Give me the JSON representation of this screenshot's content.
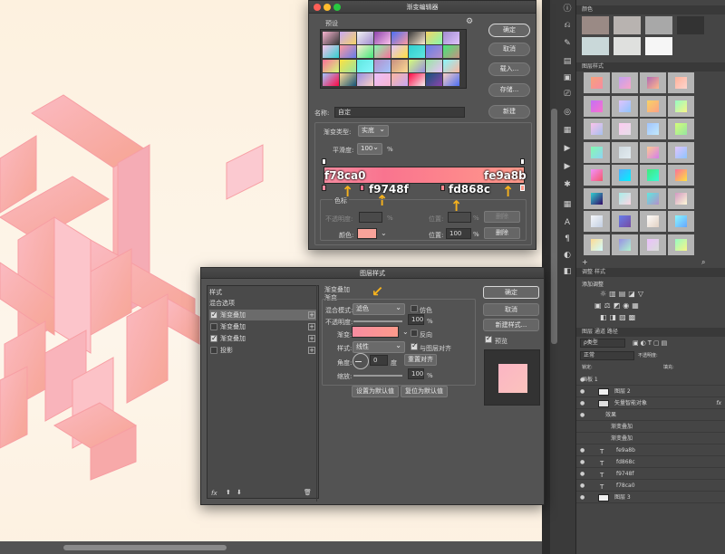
{
  "gradient_editor": {
    "title": "渐变编辑器",
    "presets_label": "预设",
    "gear_icon": "gear-icon",
    "buttons": {
      "ok": "确定",
      "cancel": "取消",
      "load": "载入...",
      "save": "存储...",
      "new": "新建"
    },
    "name_label": "名称:",
    "name_value": "自定",
    "type_label": "渐变类型:",
    "type_value": "实底",
    "smooth_label": "平滑度:",
    "smooth_value": "100",
    "smooth_unit": "%",
    "stops": [
      {
        "hex": "f78ca0",
        "color": "#f78ca0"
      },
      {
        "hex": "f9748f",
        "color": "#f9748f"
      },
      {
        "hex": "fd868c",
        "color": "#fd868c"
      },
      {
        "hex": "fe9a8b",
        "color": "#fe9a8b"
      }
    ],
    "color_stop_label": "色标",
    "opacity_label": "不透明度:",
    "opacity_unit": "%",
    "location_label": "位置:",
    "location_unit": "%",
    "delete_label": "删除",
    "color_label": "颜色:",
    "color_value": "#f9a39a",
    "location_value": "100",
    "delete2_label": "删除",
    "preset_colors": [
      "#f7b4d0",
      "#c9a8f4",
      "#f1f1f1",
      "#8e44ad",
      "#4c6ef5",
      "#3a3a3a",
      "#f6d365",
      "#a18cd1",
      "#fbc2eb",
      "#ff9a9e",
      "#ffecd2",
      "#84fab0",
      "#e0c3fc",
      "#30cfd0",
      "#667eea",
      "#43e97b",
      "#fa709a",
      "#fee140",
      "#5ee7df",
      "#b490ca",
      "#c79081",
      "#d4fc79",
      "#96e6a1",
      "#89f7fe",
      "#a1c4fd",
      "#fddb92",
      "#9890e3",
      "#ebc0fd",
      "#fcb69f",
      "#ff0844",
      "#13547a",
      "#fad0c4"
    ]
  },
  "layer_style": {
    "title": "图层样式",
    "styles_header": "样式",
    "blend_options": "混合选项",
    "items": [
      {
        "label": "渐变叠加",
        "checked": true,
        "selected": true
      },
      {
        "label": "渐变叠加",
        "checked": false,
        "selected": false
      },
      {
        "label": "渐变叠加",
        "checked": true,
        "selected": false
      },
      {
        "label": "投影",
        "checked": false,
        "selected": false
      }
    ],
    "section_title": "渐变叠加",
    "section_sub": "渐变",
    "blend_mode_label": "混合模式:",
    "blend_mode_value": "滤色",
    "dither_label": "仿色",
    "opacity_label": "不透明度:",
    "opacity_value": "100",
    "gradient_label": "渐变:",
    "reverse_label": "反向",
    "style_label": "样式:",
    "style_value": "线性",
    "align_label": "与图层对齐",
    "angle_label": "角度:",
    "angle_value": "0",
    "angle_unit": "度",
    "reset_align": "重置对齐",
    "scale_label": "缩放:",
    "scale_value": "100",
    "percent": "%",
    "set_default": "设置为默认值",
    "reset_default": "复位为默认值",
    "buttons": {
      "ok": "确定",
      "cancel": "取消",
      "new_style": "新建样式...",
      "preview": "预览"
    },
    "fx_label": "fx"
  },
  "panels": {
    "swatches_tab": "颜色",
    "swatch_colors": [
      "#9a8a85",
      "#b8b3b0",
      "#a8a8a8",
      "#333333",
      "#c9d8d9",
      "#dfe0de",
      "#f6f6f6"
    ],
    "gradient_styles_tab": "图层样式",
    "gradient_swatches": [
      [
        "#f7a17b",
        "#f78ca0"
      ],
      [
        "#c1a1f0",
        "#f9a4c8"
      ],
      [
        "#b06ab3",
        "#ffb88c"
      ],
      [
        "#ffb199",
        "#fcd5ce"
      ],
      [
        "#c471f5",
        "#fa71cd"
      ],
      [
        "#e0c3fc",
        "#8ec5fc"
      ],
      [
        "#f6d365",
        "#fda085"
      ],
      [
        "#96fbc4",
        "#f9f586"
      ],
      [
        "#fbc2eb",
        "#a6c1ee"
      ],
      [
        "#fdcbf1",
        "#e6dee9"
      ],
      [
        "#a1c4fd",
        "#c2e9fb"
      ],
      [
        "#d4fc79",
        "#96e6a1"
      ],
      [
        "#84fab0",
        "#8fd3f4"
      ],
      [
        "#cfd9df",
        "#e2ebf0"
      ],
      [
        "#fccb90",
        "#d57eeb"
      ],
      [
        "#e0c3fc",
        "#8ec5fc"
      ],
      [
        "#f093fb",
        "#f5576c"
      ],
      [
        "#4facfe",
        "#00f2fe"
      ],
      [
        "#43e97b",
        "#38f9d7"
      ],
      [
        "#fa709a",
        "#fee140"
      ],
      [
        "#30cfd0",
        "#330867"
      ],
      [
        "#a8edea",
        "#fed6e3"
      ],
      [
        "#5ee7df",
        "#b490ca"
      ],
      [
        "#d299c2",
        "#fef9d7"
      ],
      [
        "#f5f7fa",
        "#c3cfe2"
      ],
      [
        "#667eea",
        "#764ba2"
      ],
      [
        "#fdfcfb",
        "#e2d1c3"
      ],
      [
        "#89f7fe",
        "#66a6ff"
      ],
      [
        "#fddb92",
        "#d1fdff"
      ],
      [
        "#9890e3",
        "#b1f4cf"
      ],
      [
        "#ebc0fd",
        "#d9ded8"
      ],
      [
        "#96fbc4",
        "#f9f586"
      ]
    ],
    "adjust_tab": "调整",
    "styles_tab2": "样式",
    "add_adjust": "添加调整",
    "layers_tab": "图层",
    "channels_tab": "通道",
    "paths_tab": "路径",
    "kind_label": "ρ类型",
    "mode_label": "正常",
    "opacity_label": "不透明度:",
    "lock_label": "锁定:",
    "fill_label": "填充:",
    "layers": [
      {
        "name": "画板 1",
        "kind": "artboard"
      },
      {
        "name": "图层 2",
        "kind": "layer"
      },
      {
        "name": "矢量智能对象",
        "kind": "smart"
      },
      {
        "name": "效果",
        "kind": "fx"
      },
      {
        "name": "渐变叠加",
        "kind": "fx-item"
      },
      {
        "name": "渐变叠加",
        "kind": "fx-item"
      },
      {
        "name": "fe9a8b",
        "kind": "text"
      },
      {
        "name": "fd868c",
        "kind": "text"
      },
      {
        "name": "f9748f",
        "kind": "text"
      },
      {
        "name": "f78ca0",
        "kind": "text"
      },
      {
        "name": "图层 3",
        "kind": "layer"
      }
    ]
  }
}
